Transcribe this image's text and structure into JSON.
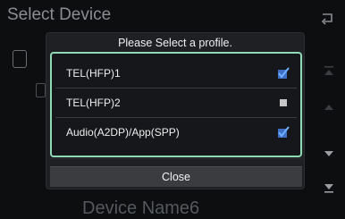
{
  "background": {
    "title": "Select Device",
    "device_name": "Device Name6"
  },
  "dialog": {
    "title": "Please Select a profile.",
    "profiles": [
      {
        "label": "TEL(HFP)1",
        "checked": true
      },
      {
        "label": "TEL(HFP)2",
        "checked": false
      },
      {
        "label": "Audio(A2DP)/App(SPP)",
        "checked": true
      }
    ],
    "close_label": "Close"
  },
  "colors": {
    "accent": "#8fd9b5",
    "check": "#4a7fd6"
  },
  "icons": {
    "back": "back-arrow-icon",
    "checked": "checkmark-icon",
    "unchecked": "checkbox-empty-icon"
  }
}
